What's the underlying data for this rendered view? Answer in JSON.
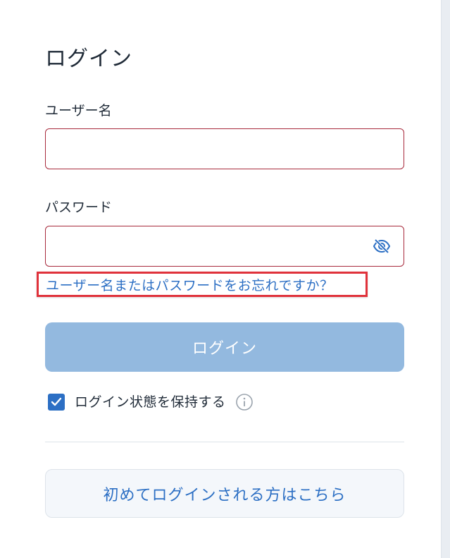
{
  "page": {
    "title": "ログイン"
  },
  "form": {
    "username_label": "ユーザー名",
    "username_value": "",
    "password_label": "パスワード",
    "password_value": "",
    "forgot_link": "ユーザー名またはパスワードをお忘れですか？",
    "login_button": "ログイン",
    "remember_label": "ログイン状態を保持する",
    "remember_checked": true
  },
  "first_login": {
    "label": "初めてログインされる方はこちら"
  },
  "icons": {
    "password_toggle": "eye-slash-icon",
    "remember_check": "check-icon",
    "remember_info": "info-icon"
  },
  "colors": {
    "accent": "#2c6fc4",
    "input_border_error": "#a82a3c",
    "login_button_disabled": "#93b9df",
    "highlight_box": "#e0323b"
  }
}
